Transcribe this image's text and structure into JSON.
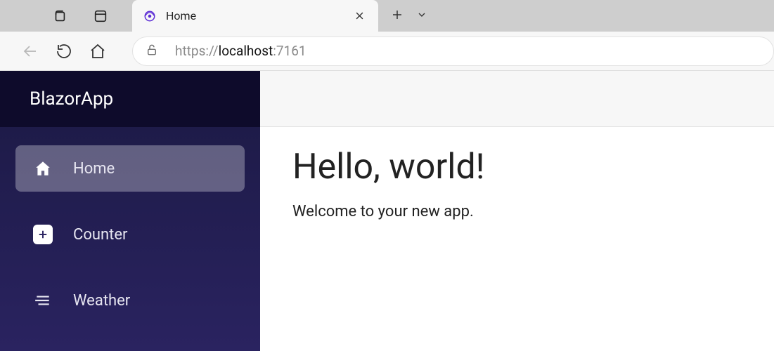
{
  "browser": {
    "tab_title": "Home",
    "url_protocol": "https://",
    "url_host": "localhost",
    "url_port": ":7161"
  },
  "sidebar": {
    "app_name": "BlazorApp",
    "items": [
      {
        "label": "Home"
      },
      {
        "label": "Counter"
      },
      {
        "label": "Weather"
      }
    ]
  },
  "content": {
    "heading": "Hello, world!",
    "subtext": "Welcome to your new app."
  }
}
